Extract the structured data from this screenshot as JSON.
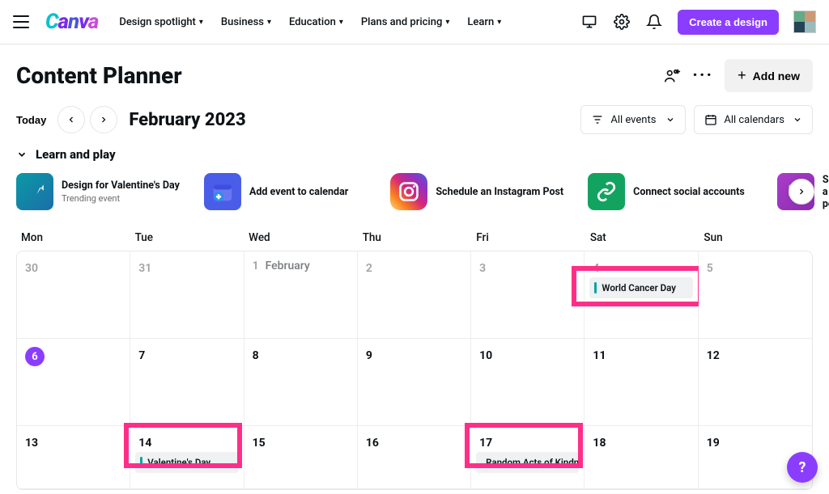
{
  "topnav": {
    "items": [
      {
        "label": "Design spotlight"
      },
      {
        "label": "Business"
      },
      {
        "label": "Education"
      },
      {
        "label": "Plans and pricing"
      },
      {
        "label": "Learn"
      }
    ],
    "create_label": "Create a design"
  },
  "page": {
    "title": "Content Planner",
    "add_new": "Add new"
  },
  "toolbar": {
    "today": "Today",
    "month_label": "February 2023",
    "filter_events": "All events",
    "filter_calendars": "All calendars"
  },
  "learn": {
    "title": "Learn and play",
    "cards": [
      {
        "title": "Design for Valentine's Day",
        "sub": "Trending event"
      },
      {
        "title": "Add event to calendar",
        "sub": ""
      },
      {
        "title": "Schedule an Instagram Post",
        "sub": ""
      },
      {
        "title": "Connect social accounts",
        "sub": ""
      },
      {
        "title": "Schedule a social post",
        "sub": ""
      }
    ]
  },
  "calendar": {
    "weekdays": [
      "Mon",
      "Tue",
      "Wed",
      "Thu",
      "Fri",
      "Sat",
      "Sun"
    ],
    "month_tag": "February",
    "rows": [
      [
        {
          "n": "30"
        },
        {
          "n": "31"
        },
        {
          "n": "1",
          "month": true
        },
        {
          "n": "2"
        },
        {
          "n": "3"
        },
        {
          "n": "4"
        },
        {
          "n": "5"
        }
      ],
      [
        {
          "n": "6",
          "today": true
        },
        {
          "n": "7"
        },
        {
          "n": "8"
        },
        {
          "n": "9"
        },
        {
          "n": "10"
        },
        {
          "n": "11"
        },
        {
          "n": "12"
        }
      ],
      [
        {
          "n": "13"
        },
        {
          "n": "14"
        },
        {
          "n": "15"
        },
        {
          "n": "16"
        },
        {
          "n": "17"
        },
        {
          "n": "18"
        },
        {
          "n": "19"
        }
      ]
    ],
    "events": {
      "r0c5": {
        "label": "World Cancer Day",
        "bar": "#0aa3a3"
      },
      "r2c1": {
        "label": "Valentine's Day",
        "bar": "#0aa3a3"
      },
      "r2c4": {
        "label": "Random Acts of Kindn...",
        "bar": "#1f66ff"
      }
    }
  },
  "help": "?"
}
